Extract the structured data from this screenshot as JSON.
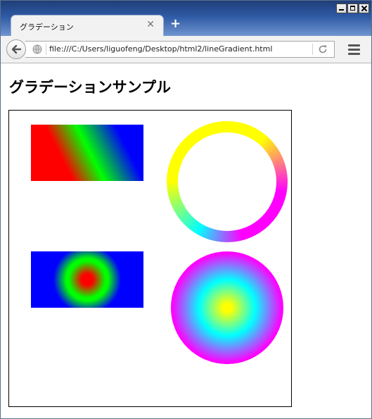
{
  "window": {
    "tab_title": "グラデーション",
    "tab_close_icon": "close-icon",
    "new_tab_icon": "plus-icon"
  },
  "navbar": {
    "back_icon": "back-arrow-icon",
    "url": "file:///C:/Users/liguofeng/Desktop/html2/lineGradient.html",
    "reload_icon": "reload-icon",
    "menu_icon": "hamburger-menu-icon"
  },
  "page": {
    "heading": "グラデーションサンプル"
  },
  "colors": {
    "linear_gradient": [
      "#ff0000",
      "#00ff00",
      "#0000ff"
    ],
    "ring_gradient": [
      "#ffff00",
      "#ff00ff",
      "#00ffff"
    ],
    "radial_rect_gradient": [
      "#ff0000",
      "#00ff00",
      "#0000ff"
    ],
    "radial_circle_gradient": [
      "#ffff00",
      "#00ffff",
      "#ff00ff"
    ]
  }
}
